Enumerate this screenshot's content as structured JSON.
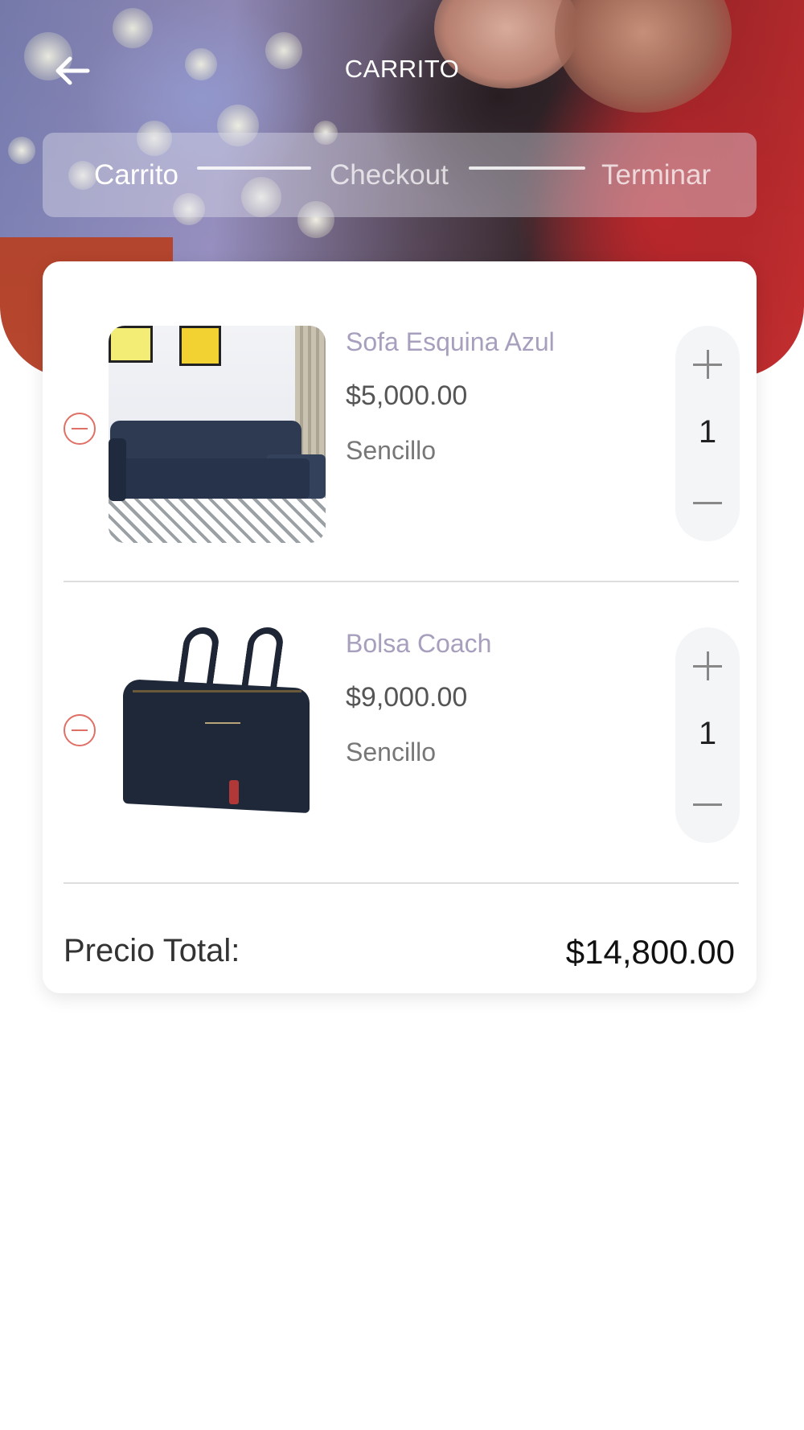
{
  "header": {
    "title": "CARRITO",
    "back_icon": "arrow-left-icon"
  },
  "stepper": {
    "steps": [
      {
        "label": "Carrito",
        "active": true
      },
      {
        "label": "Checkout",
        "active": false
      },
      {
        "label": "Terminar",
        "active": false
      }
    ]
  },
  "cart": {
    "items": [
      {
        "name": "Sofa Esquina Azul",
        "price": "$5,000.00",
        "variant": "Sencillo",
        "quantity": "1",
        "image": "sofa-image"
      },
      {
        "name": "Bolsa Coach",
        "price": "$9,000.00",
        "variant": "Sencillo",
        "quantity": "1",
        "image": "handbag-image"
      }
    ],
    "total_label": "Precio Total:",
    "total_value": "$14,800.00"
  },
  "colors": {
    "accent_remove": "#e07066",
    "item_name": "#a79fbd"
  }
}
